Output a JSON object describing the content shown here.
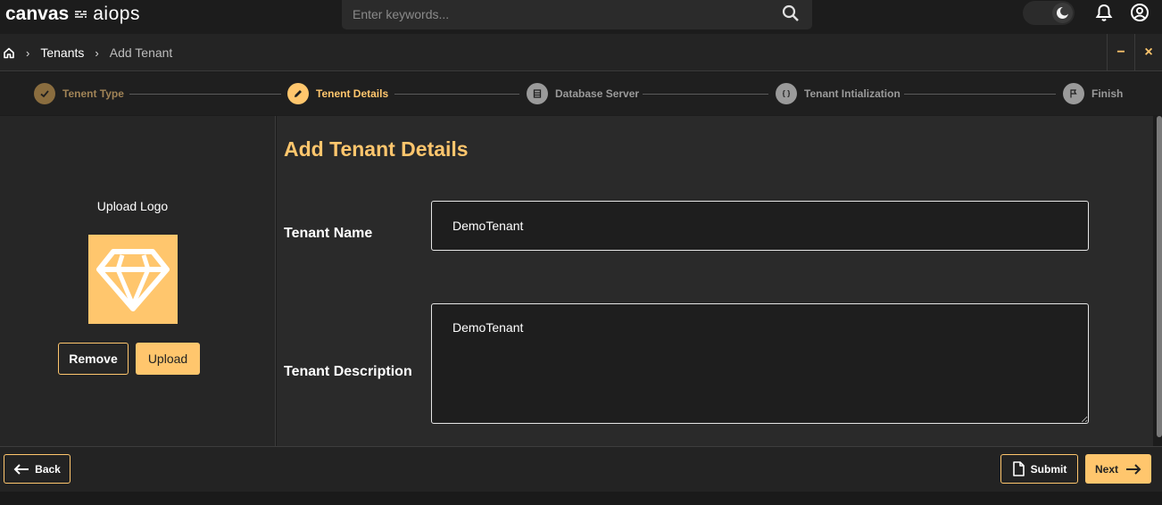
{
  "app": {
    "logo_bold": "canvas",
    "logo_light": "aiops"
  },
  "search": {
    "placeholder": "Enter keywords...",
    "icon": "search-icon"
  },
  "header_icons": [
    "theme-toggle-moon-icon",
    "bell-icon",
    "user-circle-icon"
  ],
  "breadcrumb": {
    "home_icon": "home-icon",
    "items": [
      "Tenants",
      "Add Tenant"
    ]
  },
  "window": {
    "minimize": "−",
    "close": "×"
  },
  "stepper": {
    "steps": [
      {
        "label": "Tenent Type",
        "state": "done",
        "icon": "check-icon"
      },
      {
        "label": "Tenent Details",
        "state": "active",
        "icon": "pencil-icon"
      },
      {
        "label": "Database Server",
        "state": "pending",
        "icon": "server-icon"
      },
      {
        "label": "Tenant Intialization",
        "state": "pending",
        "icon": "code-braces-icon"
      },
      {
        "label": "Finish",
        "state": "pending",
        "icon": "flag-icon"
      }
    ]
  },
  "logo_panel": {
    "title": "Upload Logo",
    "logo_icon": "diamond-icon",
    "remove_label": "Remove",
    "upload_label": "Upload"
  },
  "form": {
    "title": "Add Tenant Details",
    "name_label": "Tenant Name",
    "name_value": "DemoTenant",
    "description_label": "Tenant Description",
    "description_value": "DemoTenant"
  },
  "footer": {
    "back_label": "Back",
    "submit_label": "Submit",
    "next_label": "Next"
  },
  "colors": {
    "accent": "#ffc66d",
    "background": "#1c1c1c",
    "panel": "#2a2a2a"
  }
}
